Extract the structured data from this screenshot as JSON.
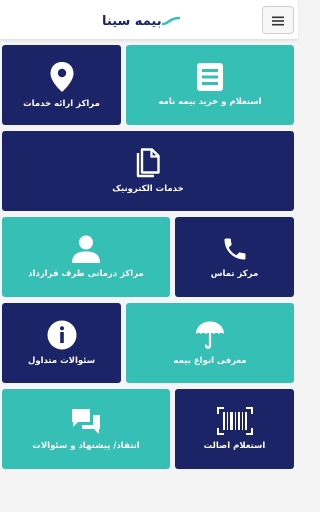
{
  "header": {
    "logo_text": "بیمه سینا",
    "menu_icon": "hamburger-icon"
  },
  "colors": {
    "navy": "#1b2466",
    "teal": "#36c0b5",
    "background": "#f4f4f4"
  },
  "tiles": [
    {
      "label": "مراکز ارائه خدمات",
      "icon": "location-pin-icon"
    },
    {
      "label": "استعلام و خرید بیمه نامه",
      "icon": "form-list-icon"
    },
    {
      "label": "خدمات الکترونیک",
      "icon": "documents-icon"
    },
    {
      "label": "مراکز درمانی طرف قرارداد",
      "icon": "person-icon"
    },
    {
      "label": "مرکز تماس",
      "icon": "phone-icon"
    },
    {
      "label": "سئوالات متداول",
      "icon": "info-icon"
    },
    {
      "label": "معرفی انواع بیمه",
      "icon": "umbrella-icon"
    },
    {
      "label": "انتقاد/ پیشنهاد و سئوالات",
      "icon": "chat-bubbles-icon"
    },
    {
      "label": "استعلام اصالت",
      "icon": "barcode-icon"
    }
  ]
}
